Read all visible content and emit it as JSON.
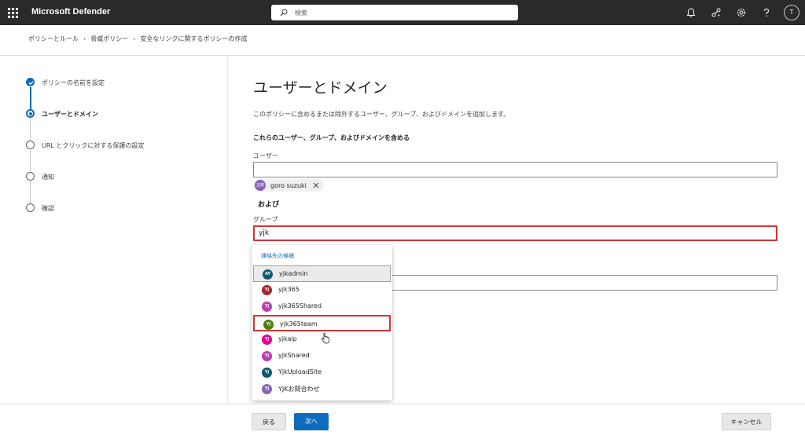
{
  "app": {
    "title": "Microsoft Defender",
    "search_placeholder": "検索",
    "user_initial": "T"
  },
  "icons": {
    "app_launcher": "waffle-icon",
    "search": "search-icon",
    "notifications": "bell-icon",
    "share": "share-icon",
    "settings": "gear-icon",
    "help": "help-icon"
  },
  "breadcrumb": [
    "ポリシーとルール",
    "脅威ポリシー",
    "安全なリンクに関するポリシーの作成"
  ],
  "wizard": {
    "steps": [
      {
        "label": "ポリシーの名前を設定",
        "state": "done"
      },
      {
        "label": "ユーザーとドメイン",
        "state": "current"
      },
      {
        "label": "URL とクリックに対する保護の設定",
        "state": "pending"
      },
      {
        "label": "通知",
        "state": "pending"
      },
      {
        "label": "確認",
        "state": "pending"
      }
    ]
  },
  "main": {
    "title": "ユーザーとドメイン",
    "description": "このポリシーに含めるまたは除外するユーザー、グループ、およびドメインを追加します。",
    "include_heading": "これらのユーザー、グループ、およびドメインを含める",
    "users_label": "ユーザー",
    "user_chip": {
      "initials": "五郎",
      "name": "goro suzuki"
    },
    "and_label": "および",
    "groups_label": "グループ",
    "groups_value": "yjk"
  },
  "suggestions": {
    "header": "連絡先の候補",
    "items": [
      {
        "initials": "AY",
        "name": "yjkadmin",
        "color": "#0b5a75",
        "state": "hover"
      },
      {
        "initials": "YJ",
        "name": "yjk365",
        "color": "#a4262c",
        "state": ""
      },
      {
        "initials": "YJ",
        "name": "yjk365Shared",
        "color": "#c239b3",
        "state": ""
      },
      {
        "initials": "YJ",
        "name": "yjk365team",
        "color": "#498205",
        "state": "selected"
      },
      {
        "initials": "YJ",
        "name": "yjkaip",
        "color": "#e3008c",
        "state": ""
      },
      {
        "initials": "YJ",
        "name": "yjkShared",
        "color": "#c239b3",
        "state": ""
      },
      {
        "initials": "YJ",
        "name": "YjkUploadSite",
        "color": "#0b5a75",
        "state": ""
      },
      {
        "initials": "YJ",
        "name": "YJKお問合わせ",
        "color": "#8764b8",
        "state": ""
      }
    ]
  },
  "footer": {
    "back_label": "戻る",
    "next_label": "次へ",
    "cancel_label": "キャンセル"
  },
  "colors": {
    "accent": "#0f6cbd",
    "highlight_border": "#d13438",
    "topbar": "#2b2a28"
  }
}
